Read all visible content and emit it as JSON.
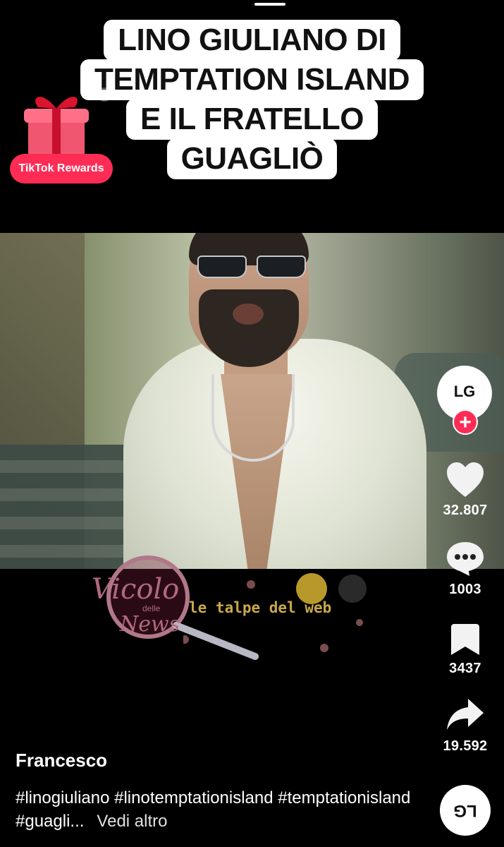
{
  "caption": {
    "lines": [
      "LINO GIULIANO DI",
      "TEMPTATION ISLAND",
      "E IL FRATELLO",
      "GUAGLIÒ"
    ]
  },
  "rewards": {
    "label": "TikTok Rewards",
    "close_icon": "×"
  },
  "watermarks": {
    "vicolo": "Vicolo delle News",
    "talpe": "le talpe del web"
  },
  "rail": {
    "avatar_initials": "LG",
    "follow_symbol": "+",
    "likes": "32.807",
    "comments": "1003",
    "saves": "3437",
    "shares": "19.592",
    "music_disc": "LG"
  },
  "post": {
    "author": "Francesco",
    "description": "#linogiuliano #linotemptationisland #temptationisland #guagli...",
    "more_label": "Vedi altro"
  },
  "colors": {
    "accent": "#fe2c55",
    "background": "#000000"
  },
  "icons": [
    "gift-icon",
    "close-icon",
    "plus-icon",
    "heart-icon",
    "comment-icon",
    "bookmark-icon",
    "share-icon",
    "music-disc-icon"
  ]
}
